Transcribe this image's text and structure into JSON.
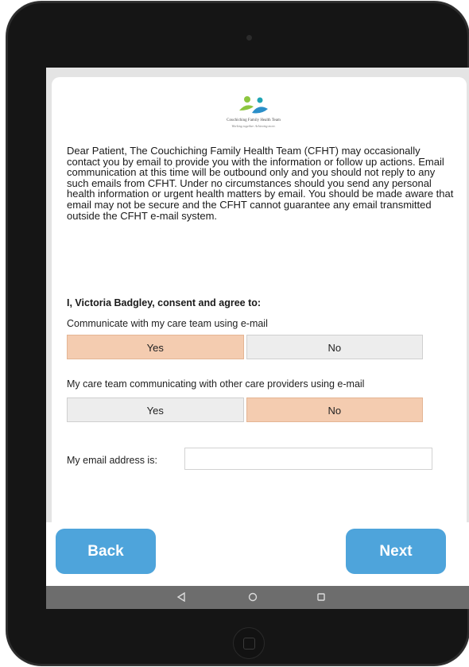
{
  "logo": {
    "name": "Couchiching Family Health Team",
    "tagline": "Working together. Achieving more.",
    "colors": {
      "green": "#8dc63f",
      "blue": "#2b8fc9",
      "teal": "#1fa5b4"
    }
  },
  "intro": "Dear Patient, The Couchiching Family Health Team (CFHT) may occasionally contact you by email to provide you with the information or follow up actions. Email communication at this time will be outbound only and you should not reply to any such emails from CFHT. Under no circumstances should you send any personal health information or urgent health matters by email. You should be made aware that email may not be secure and the CFHT cannot guarantee any email transmitted outside the CFHT e-mail system.",
  "consent": {
    "title": "I, Victoria Badgley, consent and agree to:",
    "questions": [
      {
        "label": "Communicate with my care team using e-mail",
        "yes": "Yes",
        "no": "No",
        "selected": "yes"
      },
      {
        "label": "My care team communicating with other care providers using e-mail",
        "yes": "Yes",
        "no": "No",
        "selected": "no"
      }
    ]
  },
  "email": {
    "label": "My email address is:",
    "value": "",
    "placeholder": ""
  },
  "nav": {
    "back": "Back",
    "next": "Next"
  },
  "colors": {
    "selected": "#f4ccb0",
    "unselected": "#ededed",
    "button": "#4ea4db",
    "systembar": "#6d6d6d"
  },
  "system_icons": [
    "back-triangle-icon",
    "home-circle-icon",
    "recents-square-icon"
  ]
}
